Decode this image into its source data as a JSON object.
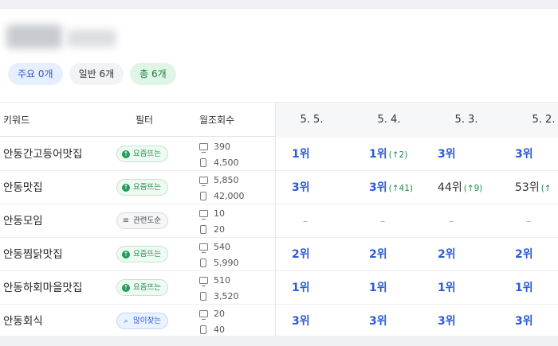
{
  "summary": {
    "major_label": "주요 0개",
    "normal_label": "일반 6개",
    "total_label": "총 6개"
  },
  "columns": {
    "keyword": "키워드",
    "filter": "필터",
    "monthly": "월조회수",
    "dates": [
      "5. 5.",
      "5. 4.",
      "5. 3.",
      "5. 2."
    ]
  },
  "icons": {
    "pc": "desktop-icon",
    "mobile": "mobile-icon",
    "trend": "trending-icon",
    "related": "filter-lines-icon",
    "search": "search-icon"
  },
  "rows": [
    {
      "keyword": "안동간고등어맛집",
      "filter": "요즘뜨는",
      "filter_type": "green",
      "pc": "390",
      "mobile": "4,500",
      "ranks": [
        {
          "r": "1위",
          "d": ""
        },
        {
          "r": "1위",
          "d": "(↑2)"
        },
        {
          "r": "3위",
          "d": ""
        },
        {
          "r": "3위",
          "d": ""
        }
      ]
    },
    {
      "keyword": "안동맛집",
      "filter": "요즘뜨는",
      "filter_type": "green",
      "pc": "5,850",
      "mobile": "42,000",
      "ranks": [
        {
          "r": "3위",
          "d": ""
        },
        {
          "r": "3위",
          "d": "(↑41)"
        },
        {
          "r": "44위",
          "d": "(↑9)"
        },
        {
          "r": "53위",
          "d": "(↑"
        }
      ]
    },
    {
      "keyword": "안동모임",
      "filter": "관련도순",
      "filter_type": "gray",
      "pc": "10",
      "mobile": "20",
      "ranks": [
        {
          "r": "–",
          "d": ""
        },
        {
          "r": "–",
          "d": ""
        },
        {
          "r": "–",
          "d": ""
        },
        {
          "r": "–",
          "d": ""
        }
      ]
    },
    {
      "keyword": "안동찜닭맛집",
      "filter": "요즘뜨는",
      "filter_type": "green",
      "pc": "540",
      "mobile": "5,990",
      "ranks": [
        {
          "r": "2위",
          "d": ""
        },
        {
          "r": "2위",
          "d": ""
        },
        {
          "r": "2위",
          "d": ""
        },
        {
          "r": "2위",
          "d": ""
        }
      ]
    },
    {
      "keyword": "안동하회마을맛집",
      "filter": "요즘뜨는",
      "filter_type": "green",
      "pc": "510",
      "mobile": "3,520",
      "ranks": [
        {
          "r": "1위",
          "d": ""
        },
        {
          "r": "1위",
          "d": ""
        },
        {
          "r": "1위",
          "d": ""
        },
        {
          "r": "1위",
          "d": ""
        }
      ]
    },
    {
      "keyword": "안동회식",
      "filter": "많이찾는",
      "filter_type": "blue",
      "pc": "20",
      "mobile": "40",
      "ranks": [
        {
          "r": "3위",
          "d": ""
        },
        {
          "r": "3위",
          "d": ""
        },
        {
          "r": "3위",
          "d": ""
        },
        {
          "r": "3위",
          "d": ""
        }
      ]
    }
  ]
}
